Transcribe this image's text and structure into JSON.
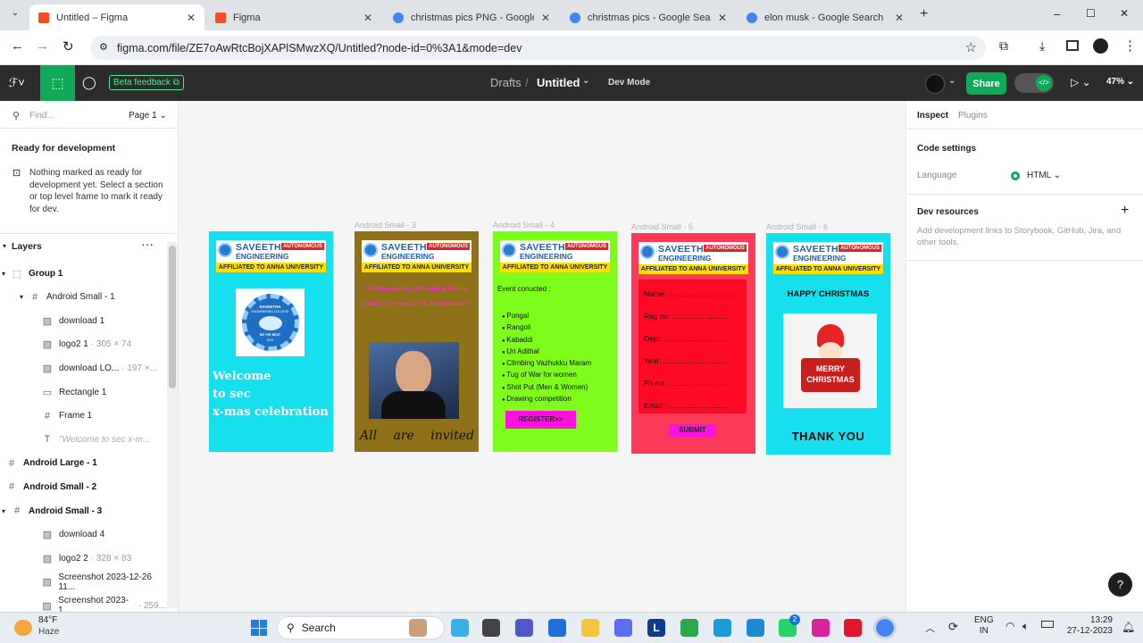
{
  "browser": {
    "tabs": [
      {
        "title": "Untitled – Figma",
        "active": true
      },
      {
        "title": "Figma",
        "active": false
      },
      {
        "title": "christmas pics PNG - Google Se",
        "active": false
      },
      {
        "title": "christmas pics - Google Search",
        "active": false
      },
      {
        "title": "elon musk - Google Search",
        "active": false
      }
    ],
    "url": "figma.com/file/ZE7oAwRtcBojXAPlSMwzXQ/Untitled?node-id=0%3A1&mode=dev",
    "new_tab": "+",
    "win_min": "–",
    "win_max": "☐",
    "win_close": "✕"
  },
  "figma": {
    "beta_feedback": "Beta feedback",
    "breadcrumb_drafts": "Drafts",
    "breadcrumb_sep": "/",
    "file_name": "Untitled",
    "dev_mode": "Dev Mode",
    "share": "Share",
    "zoom": "47%",
    "accent": "#0fa958"
  },
  "left_panel": {
    "find_placeholder": "Find...",
    "page": "Page 1",
    "ready_title": "Ready for development",
    "ready_text": "Nothing marked as ready for development yet. Select a section or top level frame to mark it ready for dev.",
    "layers_title": "Layers",
    "layers": [
      {
        "name": "Group 1",
        "meta": "",
        "icon": "group-icon",
        "indent": 0,
        "bold": true
      },
      {
        "name": "Android Small - 1",
        "meta": "",
        "icon": "frame-icon",
        "indent": 1,
        "bold": false
      },
      {
        "name": "download 1",
        "meta": "",
        "icon": "image-icon",
        "indent": 2,
        "bold": false
      },
      {
        "name": "logo2 1",
        "meta": "· 305 × 74",
        "icon": "image-icon",
        "indent": 2,
        "bold": false
      },
      {
        "name": "download LO...",
        "meta": "· 197 ×...",
        "icon": "image-icon",
        "indent": 2,
        "bold": false
      },
      {
        "name": "Rectangle 1",
        "meta": "",
        "icon": "rectangle-icon",
        "indent": 2,
        "bold": false
      },
      {
        "name": "Frame 1",
        "meta": "",
        "icon": "frame-icon",
        "indent": 2,
        "bold": false
      },
      {
        "name": "\"Welcome to sec x-m...",
        "meta": "",
        "icon": "text-icon",
        "indent": 2,
        "bold": false,
        "muted": true
      },
      {
        "name": "Android Large - 1",
        "meta": "",
        "icon": "frame-icon",
        "indent": 0,
        "bold": true
      },
      {
        "name": "Android Small - 2",
        "meta": "",
        "icon": "frame-icon",
        "indent": 0,
        "bold": true
      },
      {
        "name": "Android Small - 3",
        "meta": "",
        "icon": "frame-icon",
        "indent": 0,
        "bold": true
      },
      {
        "name": "download 4",
        "meta": "",
        "icon": "image-icon",
        "indent": 2,
        "bold": false
      },
      {
        "name": "logo2 2",
        "meta": "· 328 × 83",
        "icon": "image-icon",
        "indent": 2,
        "bold": false
      },
      {
        "name": "Screenshot 2023-12-26 11...",
        "meta": "",
        "icon": "image-icon",
        "indent": 2,
        "bold": false
      },
      {
        "name": "Screenshot 2023-1...",
        "meta": "· 259...",
        "icon": "image-icon",
        "indent": 2,
        "bold": false
      }
    ]
  },
  "right_panel": {
    "tab_inspect": "Inspect",
    "tab_plugins": "Plugins",
    "code_settings": "Code settings",
    "language_label": "Language",
    "language_value": "HTML",
    "dev_resources": "Dev resources",
    "dev_resources_text": "Add development links to Storybook, GitHub, Jira, and other tools."
  },
  "frames": [
    {
      "label": "",
      "bg": "#16dfee",
      "welcome": [
        "Welcome",
        "to sec",
        "x-mas celebration"
      ]
    },
    {
      "label": "Android Small - 3",
      "bg": "#8e7118",
      "top_text": "The Management, Principal & Faculty invites to the sec all for the celebration",
      "invite": "All are invited"
    },
    {
      "label": "Android Small - 4",
      "bg": "#7efc1c",
      "event_title": "Event conucted :",
      "events": [
        "Pongal",
        "Rangoli",
        "Kabaddi",
        "Uri Adithal",
        "Climbing Vazhukku Maram",
        "Tug of War for women",
        "Shot Put (Men & Women)",
        "Drawing competition"
      ],
      "register": "REGISTER>>"
    },
    {
      "label": "Android Small - 5",
      "bg": "#fb3a5a",
      "fields": [
        "Name: ...............................",
        "Reg no: ...........................",
        "Dept: .............................",
        "Year: .............................",
        "Ph no: ............................",
        "Email : ............................"
      ],
      "submit": "SUBMIT"
    },
    {
      "label": "Android Small - 6",
      "bg": "#16dfee",
      "greeting": "HAPPY CHRISTMAS",
      "card": [
        "MERRY",
        "CHRISTMAS"
      ],
      "thanks": "THANK YOU"
    }
  ],
  "logo": {
    "line1": "SAVEETHA",
    "line2": "ENGINEERING COLLEGE",
    "badge": "AUTONOMOUS",
    "affiliation": "AFFILIATED TO ANNA UNIVERSITY"
  },
  "seal": {
    "title": "SAVEETHA",
    "subtitle": "ENGINEERING COLLEGE",
    "motto": "BE THE BEST",
    "year": "2001"
  },
  "taskbar": {
    "weather_temp": "84°F",
    "weather_desc": "Haze",
    "search": "Search",
    "lang1": "ENG",
    "lang2": "IN",
    "time": "13:29",
    "date": "27-12-2023",
    "badge": "2"
  }
}
